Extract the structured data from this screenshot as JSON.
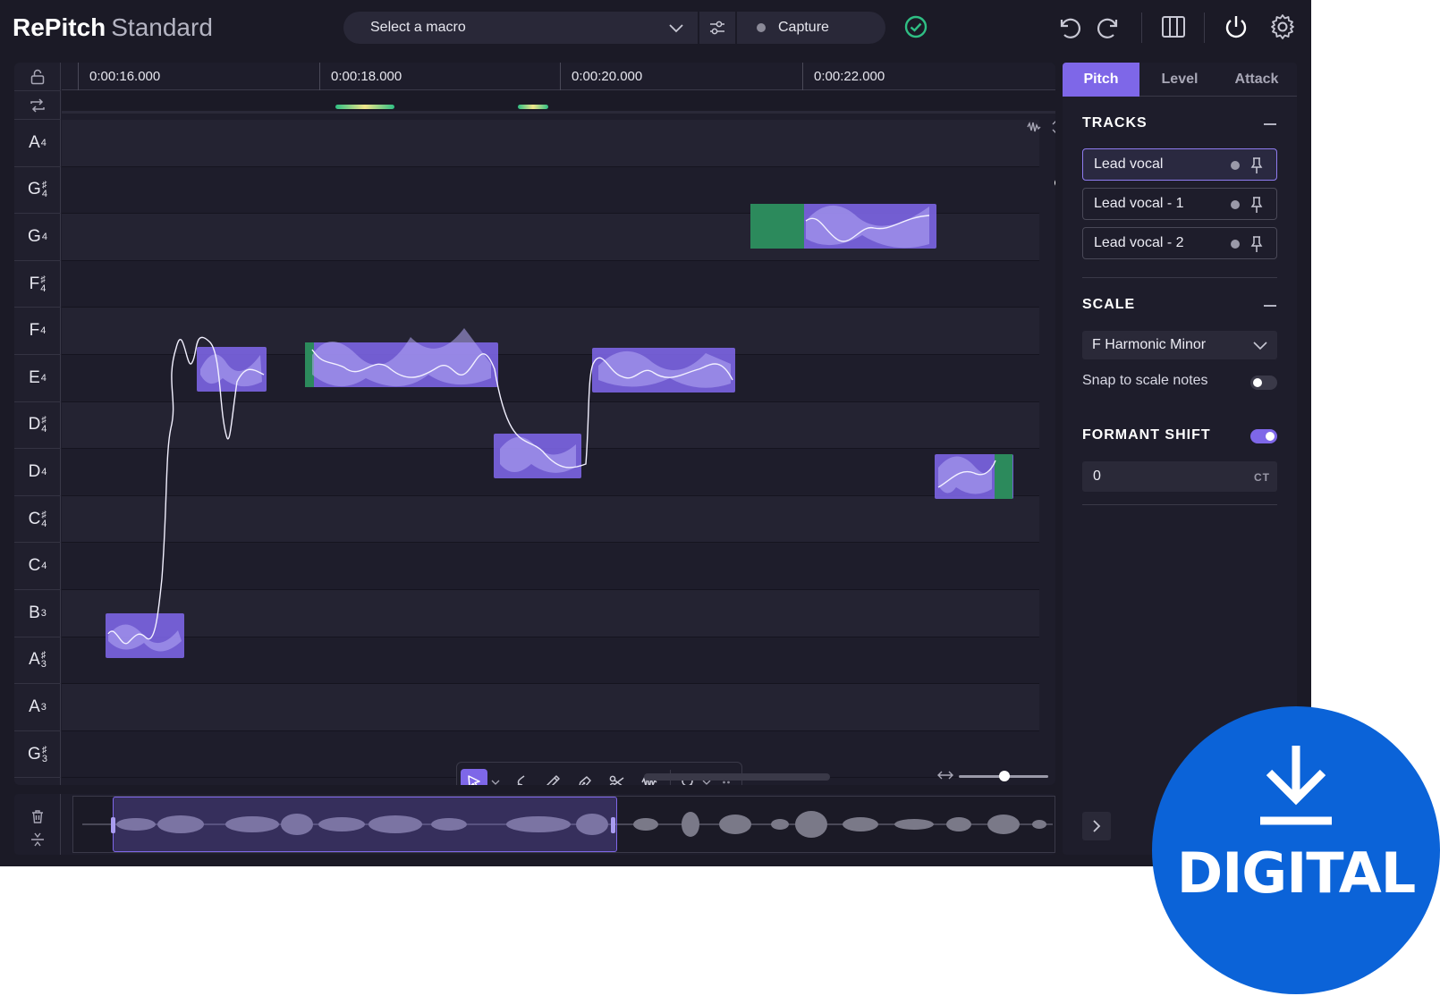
{
  "app": {
    "name": "RePitch",
    "edition": "Standard"
  },
  "topbar": {
    "macro_placeholder": "Select a macro",
    "capture_label": "Capture",
    "icons": [
      "undo-icon",
      "redo-icon",
      "layout-icon",
      "power-icon",
      "gear-icon"
    ]
  },
  "ruler": {
    "labels": [
      "0:00:16.000",
      "0:00:18.000",
      "0:00:20.000",
      "0:00:22.000"
    ]
  },
  "piano_keys": [
    {
      "letter": "A",
      "accidental": "",
      "octave": "4"
    },
    {
      "letter": "G",
      "accidental": "♯",
      "octave": "4"
    },
    {
      "letter": "G",
      "accidental": "",
      "octave": "4"
    },
    {
      "letter": "F",
      "accidental": "♯",
      "octave": "4"
    },
    {
      "letter": "F",
      "accidental": "",
      "octave": "4"
    },
    {
      "letter": "E",
      "accidental": "",
      "octave": "4"
    },
    {
      "letter": "D",
      "accidental": "♯",
      "octave": "4"
    },
    {
      "letter": "D",
      "accidental": "",
      "octave": "4"
    },
    {
      "letter": "C",
      "accidental": "♯",
      "octave": "4"
    },
    {
      "letter": "C",
      "accidental": "",
      "octave": "4"
    },
    {
      "letter": "B",
      "accidental": "",
      "octave": "3"
    },
    {
      "letter": "A",
      "accidental": "♯",
      "octave": "3"
    },
    {
      "letter": "A",
      "accidental": "",
      "octave": "3"
    },
    {
      "letter": "G",
      "accidental": "♯",
      "octave": "3"
    }
  ],
  "tools": [
    "select-tool-icon",
    "pitch-drift-tool-icon",
    "pencil-tool-icon",
    "pen-tool-icon",
    "scissors-tool-icon",
    "waveform-tool-icon",
    "zoom-tool-icon"
  ],
  "side": {
    "tabs": [
      {
        "label": "Pitch",
        "active": true
      },
      {
        "label": "Level",
        "active": false
      },
      {
        "label": "Attack",
        "active": false
      }
    ],
    "tracks_heading": "TRACKS",
    "tracks": [
      {
        "label": "Lead vocal",
        "selected": true
      },
      {
        "label": "Lead vocal - 1",
        "selected": false
      },
      {
        "label": "Lead vocal - 2",
        "selected": false
      }
    ],
    "scale_heading": "SCALE",
    "scale_value": "F Harmonic Minor",
    "snap_label": "Snap to scale notes",
    "snap_enabled": false,
    "formant_heading": "FORMANT SHIFT",
    "formant_enabled": true,
    "formant_value": "0",
    "formant_unit": "CT"
  },
  "badge": {
    "text": "DIGITAL",
    "color": "#0b63d8"
  },
  "colors": {
    "accent": "#7e67e8",
    "note_green": "#2c8a5c",
    "ok_green": "#2fbf84"
  }
}
